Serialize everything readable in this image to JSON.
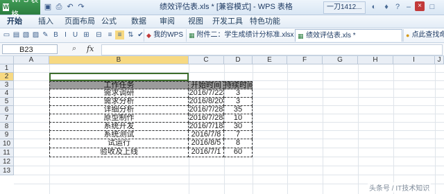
{
  "titlebar": {
    "app_name": "WPS 表格",
    "title": "绩效评估表.xls * [兼容模式] - WPS 表格",
    "user": "一刀1412...",
    "close": "×"
  },
  "menus": [
    "开始",
    "插入",
    "页面布局",
    "公式",
    "数据",
    "审阅",
    "视图",
    "开发工具",
    "特色功能"
  ],
  "doc_tabs": [
    {
      "label": "我的WPS"
    },
    {
      "label": "附件二：学生成绩计分标准.xlsx"
    },
    {
      "label": "绩效评估表.xls *"
    },
    {
      "label": "点此查找命令"
    }
  ],
  "formula_bar": {
    "cell_ref": "B23",
    "fx": "fx",
    "value": ""
  },
  "columns": [
    "A",
    "B",
    "C",
    "D",
    "E",
    "F",
    "G",
    "H",
    "I",
    "J"
  ],
  "rows": [
    "1",
    "2",
    "3",
    "4",
    "5",
    "6",
    "7",
    "8",
    "9",
    "10",
    "11",
    "12",
    "13"
  ],
  "table": {
    "headers": [
      "工作任务",
      "开始时间",
      "持续时间"
    ],
    "rows": [
      [
        "需求调研",
        "2016/7/22",
        "3"
      ],
      [
        "需求分析",
        "2016/8/20",
        "3"
      ],
      [
        "详细分析",
        "2016/7/28",
        "35"
      ],
      [
        "原型制作",
        "2016/7/28",
        "10"
      ],
      [
        "系统开发",
        "2016/7/18",
        "30"
      ],
      [
        "系统测试",
        "2016/7/8",
        "7"
      ],
      [
        "试运行",
        "2016/8/5",
        "8"
      ],
      [
        "验收及上线",
        "2016/7/1",
        "60"
      ]
    ]
  },
  "watermark": "头条号 / IT技术知识"
}
